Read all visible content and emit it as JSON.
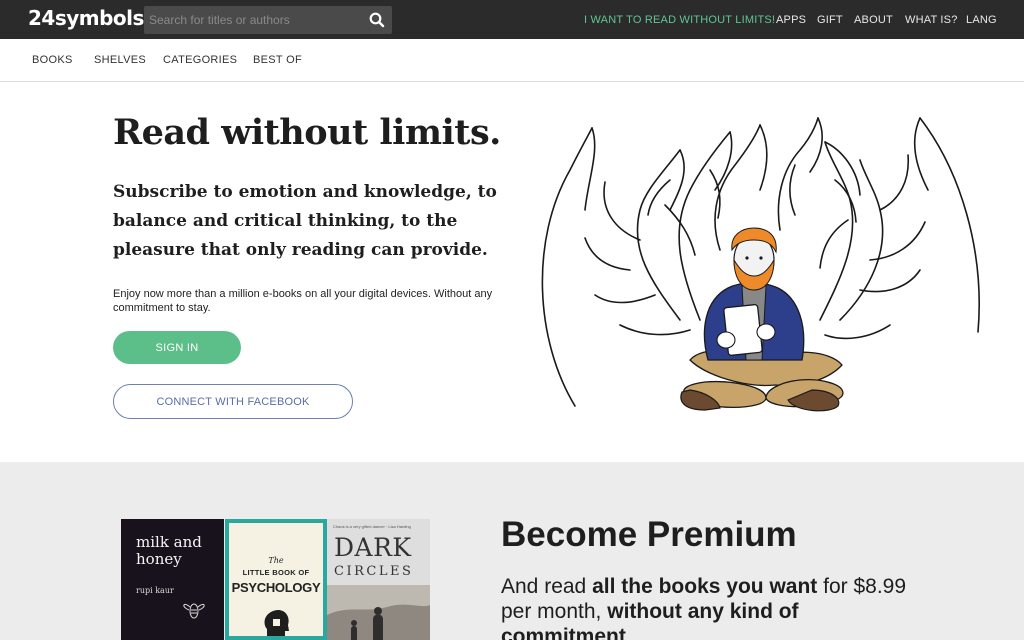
{
  "header": {
    "logo": "24symbols",
    "search_placeholder": "Search for titles or authors",
    "nav": {
      "read_unlimited": "I WANT TO READ WITHOUT LIMITS!",
      "apps": "APPS",
      "gift": "GIFT",
      "about": "ABOUT",
      "what_is": "WHAT IS?",
      "lang": "LANG"
    },
    "accent_color": "#5fc693"
  },
  "subnav": {
    "books": "BOOKS",
    "shelves": "SHELVES",
    "categories": "CATEGORIES",
    "best_of": "BEST OF"
  },
  "hero": {
    "title": "Read without limits.",
    "subtitle": "Subscribe to emotion and knowledge, to balance and critical thinking, to the pleasure that only reading can provide.",
    "text": "Enjoy now more than a million e-books on all your digital devices. Without any commitment to stay.",
    "signin_label": "SIGN IN",
    "facebook_label": "CONNECT WITH FACEBOOK",
    "signin_color": "#5cbf8a",
    "facebook_color": "#6a7fb2"
  },
  "premium": {
    "title": "Become Premium",
    "text_1": "And read ",
    "text_bold_1": "all the books you want",
    "text_2": " for $8.99 per month, ",
    "text_bold_2": "without any kind of commitment"
  },
  "books": [
    {
      "title": "milk and honey",
      "author": "rupi kaur"
    },
    {
      "the": "The",
      "little": "LITTLE BOOK OF",
      "title": "PSYCHOLOGY"
    },
    {
      "tagline": "Chaos is a very gifted dancer · Lisa Harding",
      "title_1": "DARK",
      "title_2": "CIRCLES"
    }
  ]
}
